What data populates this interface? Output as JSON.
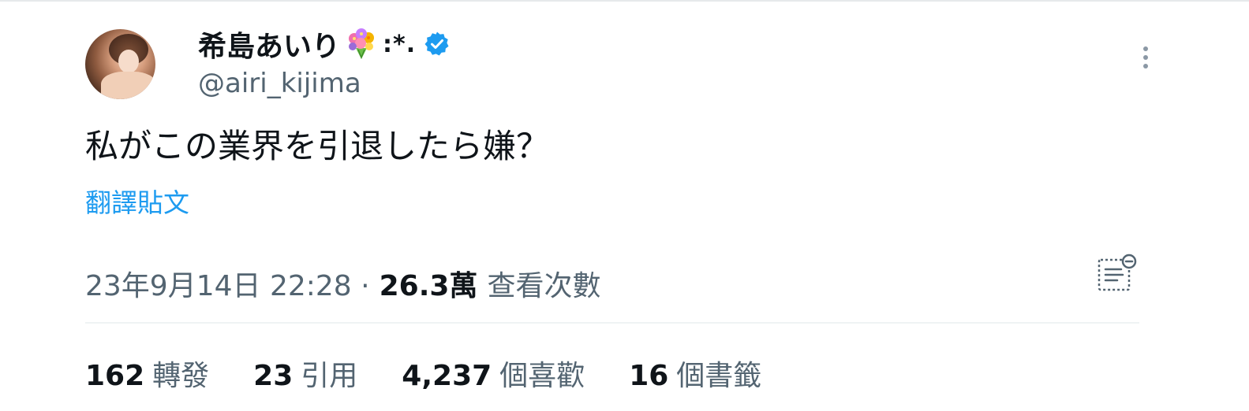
{
  "author": {
    "display_name": "希島あいり",
    "name_emoji_icon": "bouquet-icon",
    "name_suffix": ":*.",
    "verified": true,
    "handle": "@airi_kijima"
  },
  "tweet": {
    "text": "私がこの業界を引退したら嫌？",
    "translate_label": "翻譯貼文",
    "timestamp": "23年9月14日 22:28 ·",
    "views_count": "26.3萬",
    "views_label": "查看次數"
  },
  "stats": [
    {
      "num": "162",
      "label": "轉發"
    },
    {
      "num": "23",
      "label": "引用"
    },
    {
      "num": "4,237",
      "label": "個喜歡"
    },
    {
      "num": "16",
      "label": "個書籤"
    }
  ],
  "colors": {
    "accent": "#1d9bf0",
    "text_primary": "#0f1419",
    "text_secondary": "#536471",
    "divider": "#eff3f4"
  }
}
